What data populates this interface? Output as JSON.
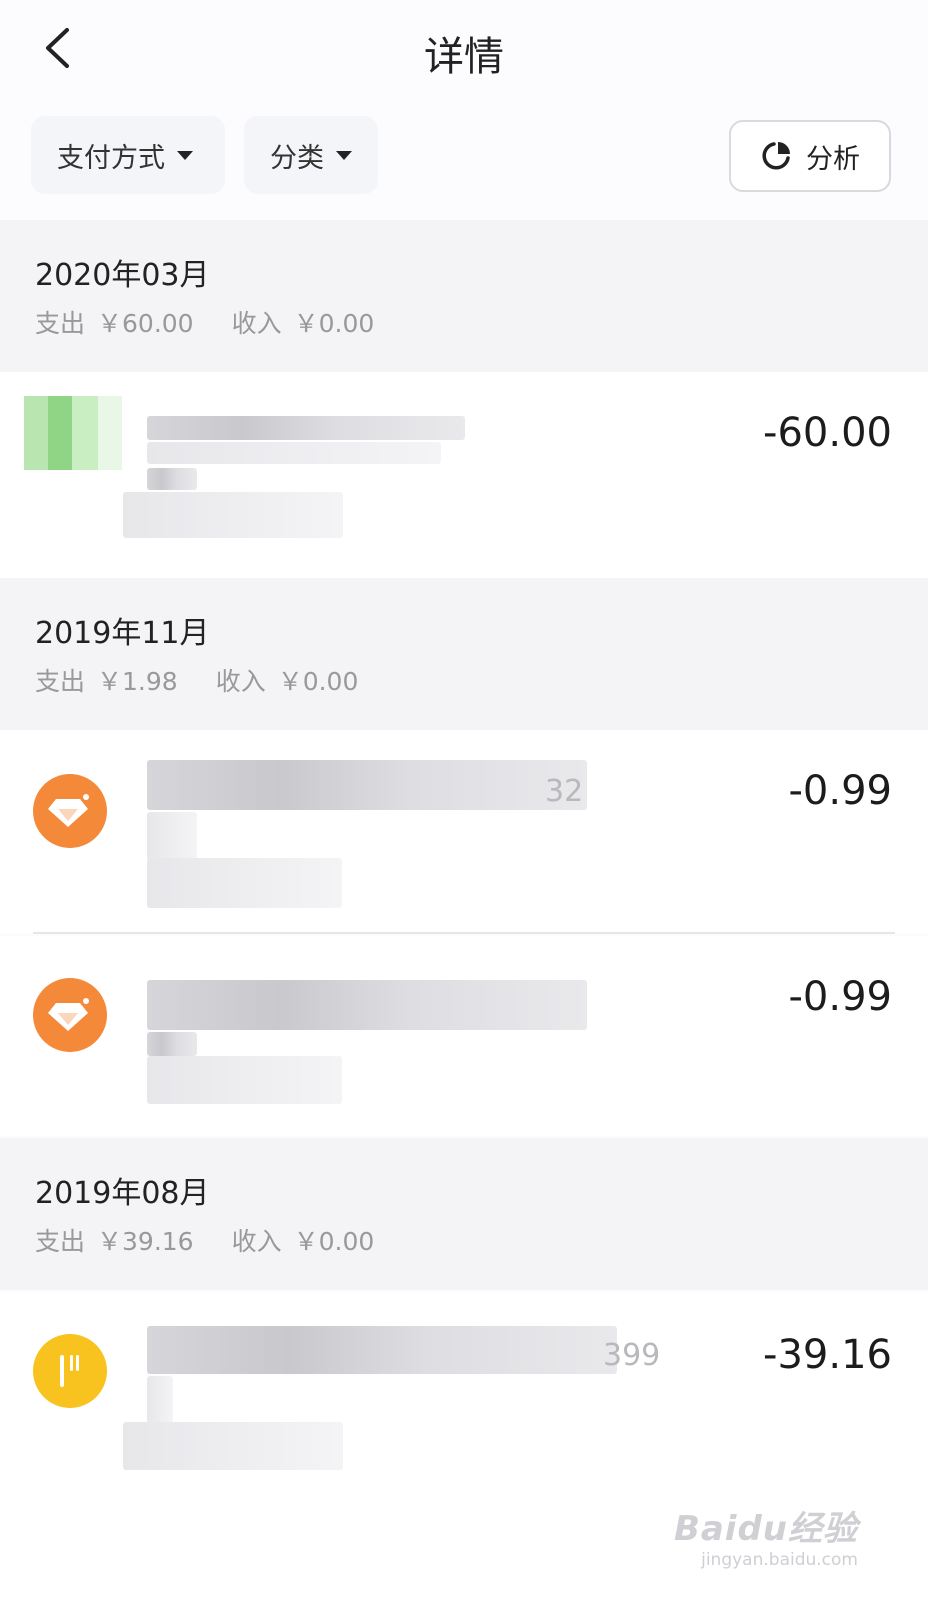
{
  "header": {
    "title": "详情"
  },
  "filters": {
    "payment_label": "支付方式",
    "category_label": "分类",
    "analyze_label": "分析"
  },
  "months": [
    {
      "title": "2020年03月",
      "expense_label": "支出",
      "expense": "￥60.00",
      "income_label": "收入",
      "income": "￥0.00"
    },
    {
      "title": "2019年11月",
      "expense_label": "支出",
      "expense": "￥1.98",
      "income_label": "收入",
      "income": "￥0.00"
    },
    {
      "title": "2019年08月",
      "expense_label": "支出",
      "expense": "￥39.16",
      "income_label": "收入",
      "income": "￥0.00"
    }
  ],
  "transactions": [
    {
      "amount": "-60.00",
      "icon": "wechat-mosaic-icon"
    },
    {
      "amount": "-0.99",
      "icon": "diamond-icon",
      "visible_fragment": "32"
    },
    {
      "amount": "-0.99",
      "icon": "diamond-icon"
    },
    {
      "amount": "-39.16",
      "icon": "food-icon",
      "visible_fragment": "399"
    }
  ],
  "watermark": {
    "line1": "Baidu经验",
    "line2": "jingyan.baidu.com"
  },
  "colors": {
    "orange": "#f5893a",
    "yellow": "#f8c31f",
    "section_bg": "#f4f4f7"
  }
}
